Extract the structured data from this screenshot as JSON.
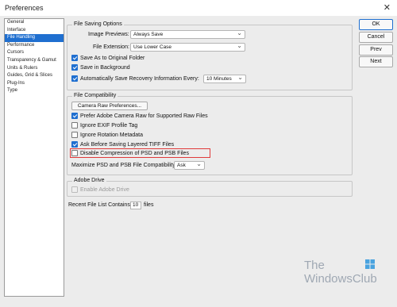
{
  "window": {
    "title": "Preferences",
    "close_glyph": "✕"
  },
  "sidebar": {
    "items": [
      {
        "label": "General",
        "selected": false
      },
      {
        "label": "Interface",
        "selected": false
      },
      {
        "label": "File Handling",
        "selected": true
      },
      {
        "label": "Performance",
        "selected": false
      },
      {
        "label": "Cursors",
        "selected": false
      },
      {
        "label": "Transparency & Gamut",
        "selected": false
      },
      {
        "label": "Units & Rulers",
        "selected": false
      },
      {
        "label": "Guides, Grid & Slices",
        "selected": false
      },
      {
        "label": "Plug-Ins",
        "selected": false
      },
      {
        "label": "Type",
        "selected": false
      }
    ]
  },
  "file_saving": {
    "legend": "File Saving Options",
    "image_previews_label": "Image Previews:",
    "image_previews_value": "Always Save",
    "file_extension_label": "File Extension:",
    "file_extension_value": "Use Lower Case",
    "save_as_original": "Save As to Original Folder",
    "save_background": "Save in Background",
    "auto_recovery": "Automatically Save Recovery Information Every:",
    "auto_recovery_value": "10 Minutes"
  },
  "file_compat": {
    "legend": "File Compatibility",
    "camera_raw_button": "Camera Raw Preferences...",
    "prefer_camera_raw": "Prefer Adobe Camera Raw for Supported Raw Files",
    "ignore_exif": "Ignore EXIF Profile Tag",
    "ignore_rotation": "Ignore Rotation Metadata",
    "ask_tiff": "Ask Before Saving Layered TIFF Files",
    "disable_compression": "Disable Compression of PSD and PSB Files",
    "maximize_label": "Maximize PSD and PSB File Compatibility:",
    "maximize_value": "Ask"
  },
  "adobe_drive": {
    "legend": "Adobe Drive",
    "enable": "Enable Adobe Drive"
  },
  "recent_files": {
    "label_before": "Recent File List Contains:",
    "value": "10",
    "label_after": "files"
  },
  "buttons": {
    "ok": "OK",
    "cancel": "Cancel",
    "prev": "Prev",
    "next": "Next"
  },
  "watermark": {
    "line1": "The",
    "line2": "WindowsClub"
  },
  "colors": {
    "accent": "#1f6fd0",
    "highlight": "#e03a3a",
    "background": "#ececec"
  }
}
